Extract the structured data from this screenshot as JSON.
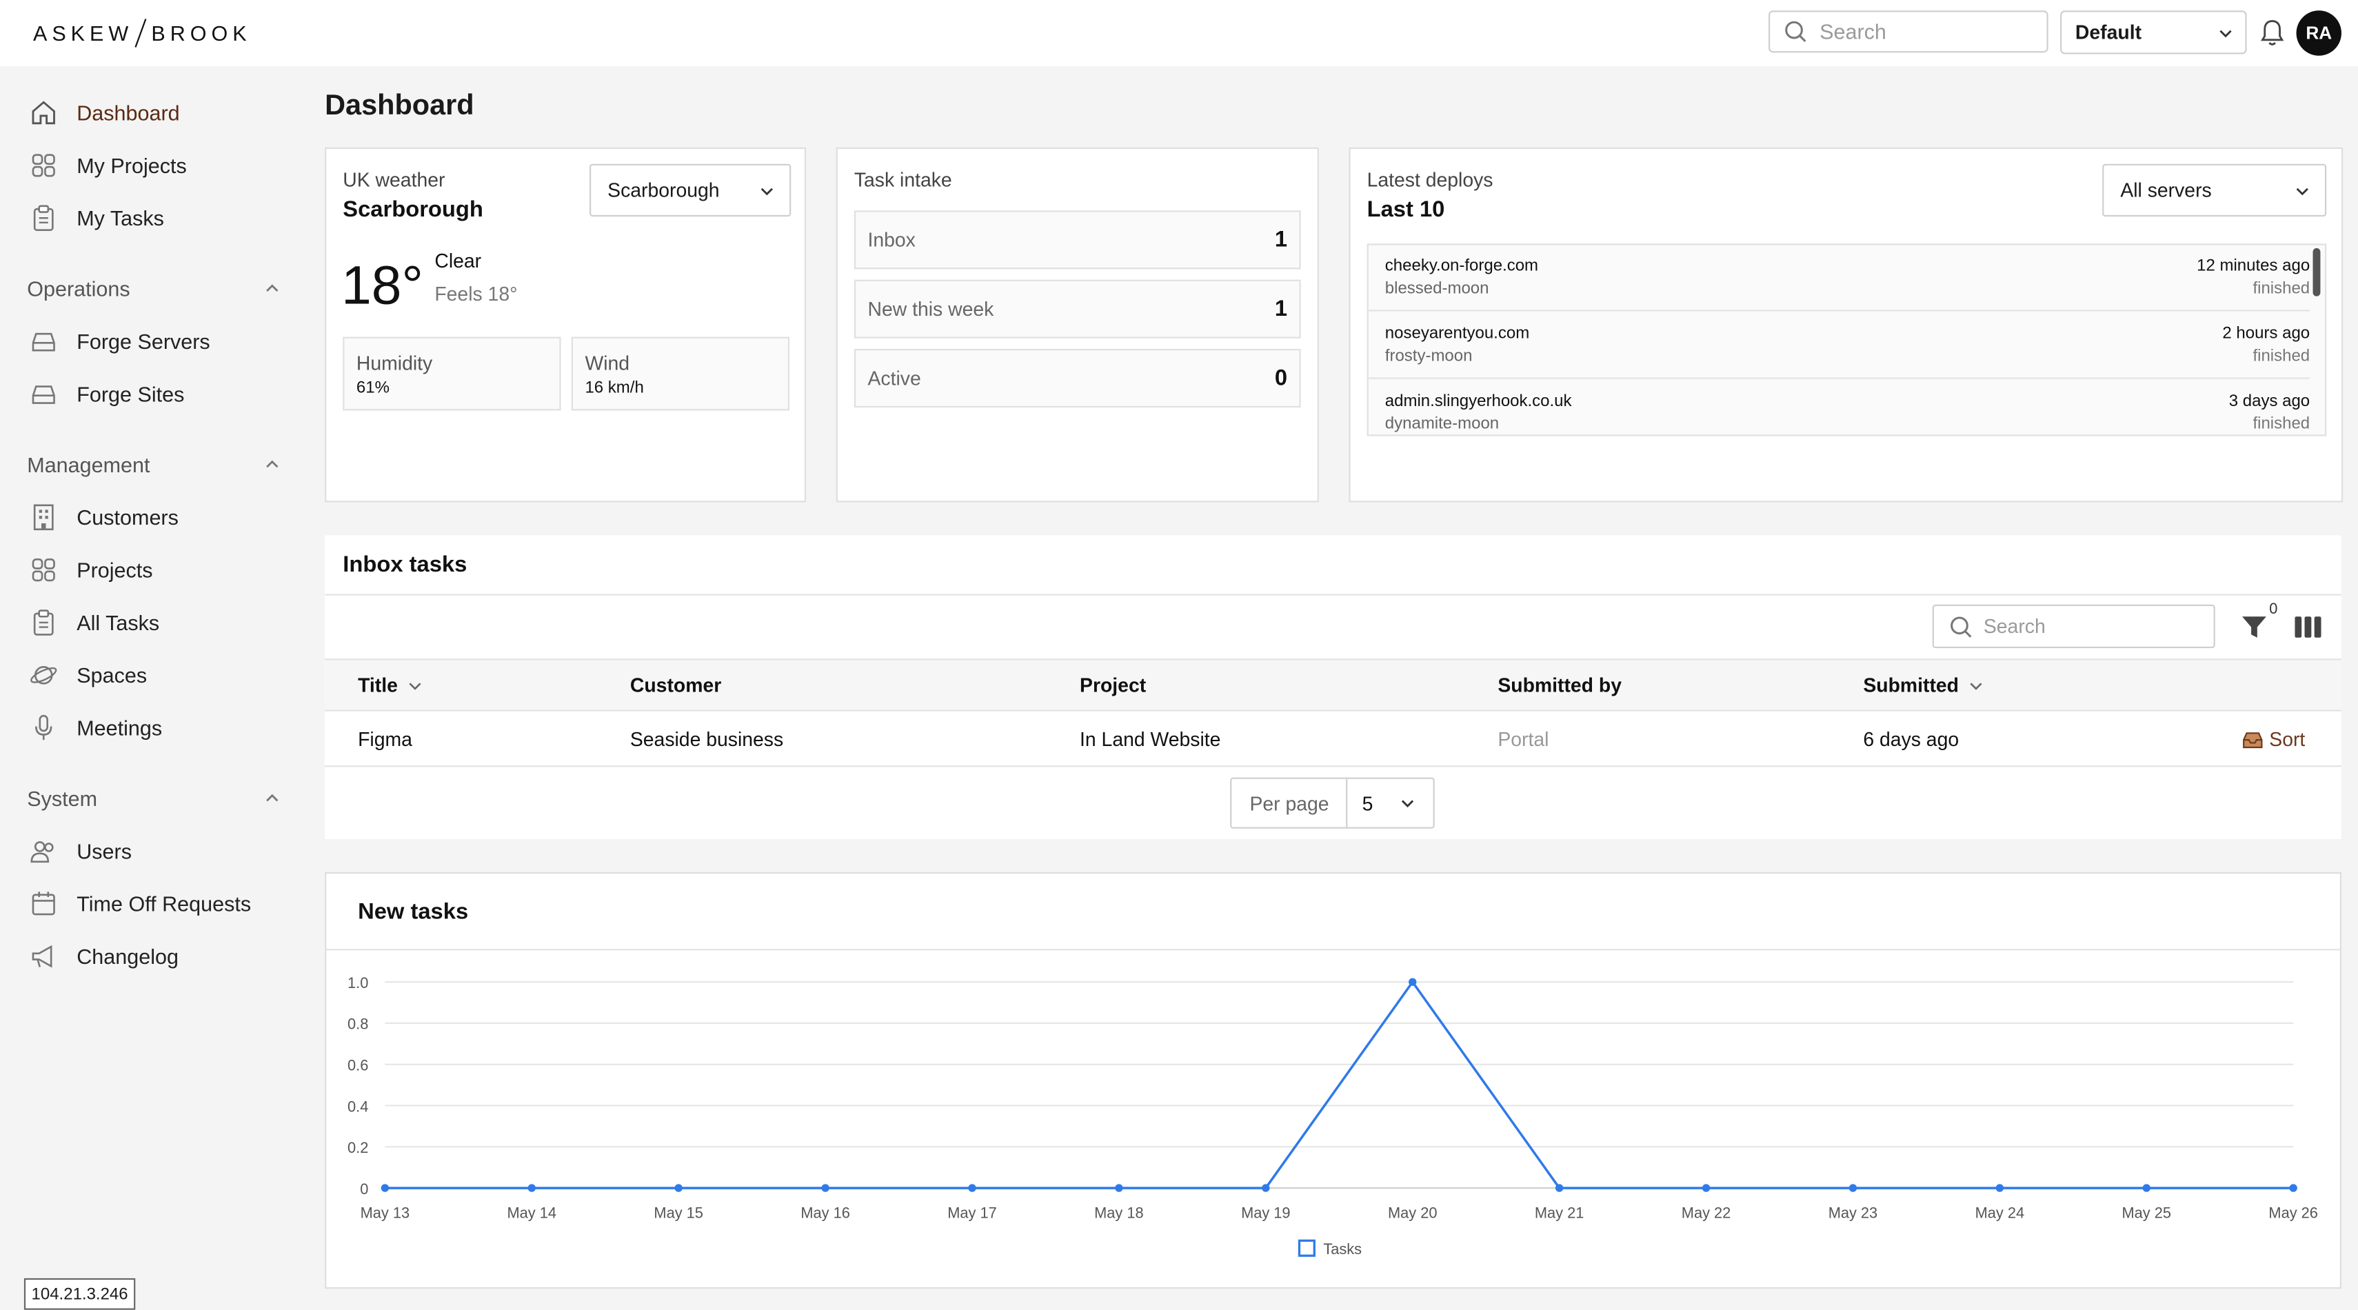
{
  "brand": {
    "left": "ASKEW",
    "right": "BROOK"
  },
  "topbar": {
    "search_placeholder": "Search",
    "workspace": "Default",
    "avatar_initials": "RA"
  },
  "sidebar": {
    "items": [
      {
        "label": "Dashboard",
        "icon": "home-icon"
      },
      {
        "label": "My Projects",
        "icon": "grid-icon"
      },
      {
        "label": "My Tasks",
        "icon": "clipboard-icon"
      }
    ],
    "groups": [
      {
        "label": "Operations",
        "items": [
          {
            "label": "Forge Servers",
            "icon": "server-icon"
          },
          {
            "label": "Forge Sites",
            "icon": "server-icon"
          }
        ]
      },
      {
        "label": "Management",
        "items": [
          {
            "label": "Customers",
            "icon": "building-icon"
          },
          {
            "label": "Projects",
            "icon": "grid-icon"
          },
          {
            "label": "All Tasks",
            "icon": "clipboard-icon"
          },
          {
            "label": "Spaces",
            "icon": "planet-icon"
          },
          {
            "label": "Meetings",
            "icon": "microphone-icon"
          }
        ]
      },
      {
        "label": "System",
        "items": [
          {
            "label": "Users",
            "icon": "users-icon"
          },
          {
            "label": "Time Off Requests",
            "icon": "calendar-icon"
          },
          {
            "label": "Changelog",
            "icon": "megaphone-icon"
          }
        ]
      }
    ]
  },
  "ip_address": "104.21.3.246",
  "page_title": "Dashboard",
  "weather": {
    "heading": "UK weather",
    "city": "Scarborough",
    "selected_city": "Scarborough",
    "temp": "18°",
    "condition": "Clear",
    "feels": "Feels 18°",
    "humidity_label": "Humidity",
    "humidity": "61%",
    "wind_label": "Wind",
    "wind": "16 km/h"
  },
  "intake": {
    "heading": "Task intake",
    "rows": [
      {
        "label": "Inbox",
        "count": "1"
      },
      {
        "label": "New this week",
        "count": "1"
      },
      {
        "label": "Active",
        "count": "0"
      }
    ]
  },
  "deploys": {
    "heading": "Latest deploys",
    "subheading": "Last 10",
    "filter": "All servers",
    "rows": [
      {
        "site": "cheeky.on-forge.com",
        "server": "blessed-moon",
        "when": "12 minutes ago",
        "status": "finished"
      },
      {
        "site": "noseyarentyou.com",
        "server": "frosty-moon",
        "when": "2 hours ago",
        "status": "finished"
      },
      {
        "site": "admin.slingyerhook.co.uk",
        "server": "dynamite-moon",
        "when": "3 days ago",
        "status": "finished"
      }
    ]
  },
  "inbox": {
    "heading": "Inbox tasks",
    "search_placeholder": "Search",
    "filter_count": "0",
    "columns": [
      "Title",
      "Customer",
      "Project",
      "Submitted by",
      "Submitted"
    ],
    "rows": [
      {
        "title": "Figma",
        "customer": "Seaside business",
        "project": "In Land Website",
        "submitted_by": "Portal",
        "submitted": "6 days ago",
        "action": "Sort"
      }
    ],
    "per_page_label": "Per page",
    "per_page": "5"
  },
  "new_tasks": {
    "heading": "New tasks"
  },
  "chart_data": {
    "type": "line",
    "title": "New tasks",
    "categories": [
      "May 13",
      "May 14",
      "May 15",
      "May 16",
      "May 17",
      "May 18",
      "May 19",
      "May 20",
      "May 21",
      "May 22",
      "May 23",
      "May 24",
      "May 25",
      "May 26"
    ],
    "series": [
      {
        "name": "Tasks",
        "values": [
          0,
          0,
          0,
          0,
          0,
          0,
          0,
          1,
          0,
          0,
          0,
          0,
          0,
          0
        ],
        "color": "#2f7ae8"
      }
    ],
    "y_ticks": [
      "0",
      "0.2",
      "0.4",
      "0.6",
      "0.8",
      "1.0"
    ],
    "ylim": [
      0,
      1
    ],
    "grid": true,
    "legend": "bottom"
  }
}
